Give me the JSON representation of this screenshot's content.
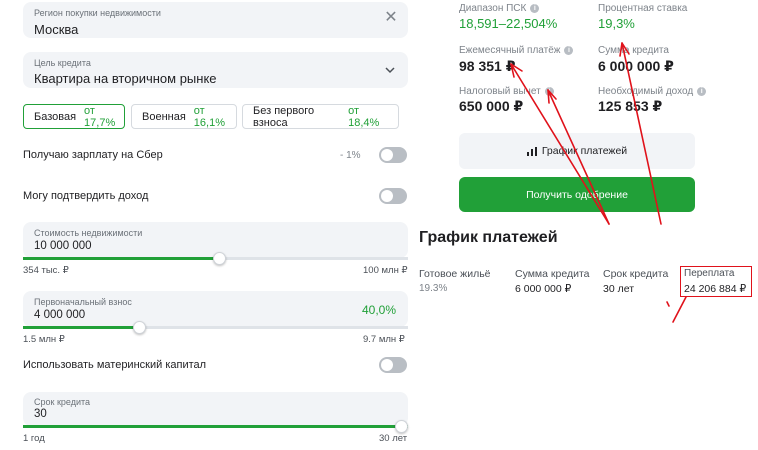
{
  "form": {
    "region": {
      "label": "Регион покупки недвижимости",
      "value": "Москва"
    },
    "purpose": {
      "label": "Цель кредита",
      "value": "Квартира на вторичном рынке"
    },
    "programs": [
      {
        "name": "Базовая",
        "rate": "от 17,7%",
        "active": true
      },
      {
        "name": "Военная",
        "rate": "от 16,1%",
        "active": false
      },
      {
        "name": "Без первого взноса",
        "rate": "от 18,4%",
        "active": false
      }
    ],
    "salary_sber": {
      "label": "Получаю зарплату на Сбер",
      "note": "- 1%"
    },
    "confirm_income": {
      "label": "Могу подтвердить доход"
    },
    "property_cost": {
      "label": "Стоимость недвижимости",
      "value": "10 000 000",
      "min": "354 тыс. ₽",
      "max": "100 млн ₽",
      "fill": 0.51
    },
    "down_payment": {
      "label": "Первоначальный взнос",
      "value": "4 000 000",
      "percent": "40,0%",
      "min": "1.5 млн ₽",
      "max": "9.7 млн ₽",
      "fill": 0.3
    },
    "maternity_capital": {
      "label": "Использовать материнский капитал"
    },
    "term": {
      "label": "Срок кредита",
      "value": "30",
      "min": "1 год",
      "max": "30 лет",
      "fill": 1.0
    }
  },
  "results": {
    "psk": {
      "label": "Диапазон ПСК",
      "value": "18,591–22,504%"
    },
    "rate": {
      "label": "Процентная ставка",
      "value": "19,3%"
    },
    "monthly": {
      "label": "Ежемесячный платёж",
      "value": "98 351 ₽"
    },
    "loan_sum": {
      "label": "Сумма кредита",
      "value": "6 000 000 ₽"
    },
    "tax": {
      "label": "Налоговый вычет",
      "value": "650 000 ₽"
    },
    "income": {
      "label": "Необходимый доход",
      "value": "125 853 ₽"
    },
    "schedule_button": "График платежей",
    "approve_button": "Получить одобрение"
  },
  "schedule": {
    "title": "График платежей",
    "product": "Готовое жильё",
    "product_rate": "19.3%",
    "sum_label": "Сумма кредита",
    "sum_value": "6 000 000 ₽",
    "term_label": "Срок кредита",
    "term_value": "30 лет",
    "overpay_label": "Переплата",
    "overpay_value": "24 206 884 ₽"
  },
  "icons": {
    "info": "info-icon",
    "chart": "bar-chart-icon",
    "close": "close-icon",
    "chevron": "chevron-down-icon"
  },
  "colors": {
    "accent": "#21a038",
    "annotation": "#e0121b"
  }
}
